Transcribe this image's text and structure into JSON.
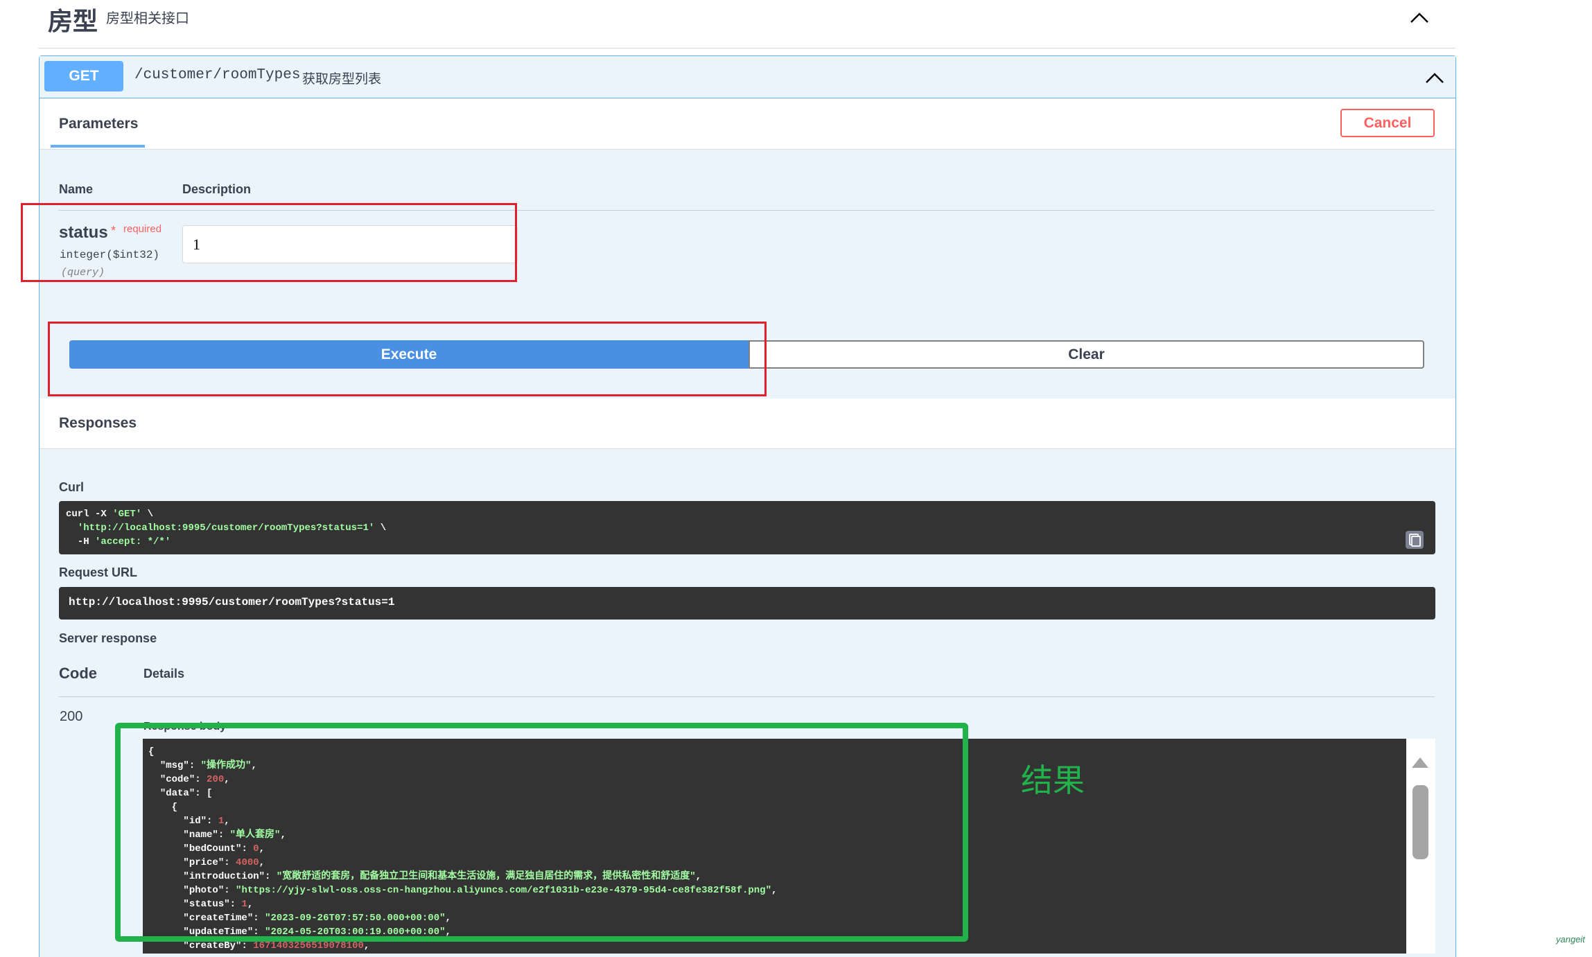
{
  "tag": {
    "name": "房型",
    "description": "房型相关接口"
  },
  "operation": {
    "method": "GET",
    "path": "/customer/roomTypes",
    "summary": "获取房型列表",
    "method_color": "#61affe"
  },
  "params_panel": {
    "tab_label": "Parameters",
    "cancel_label": "Cancel"
  },
  "param_table": {
    "col_name": "Name",
    "col_description": "Description",
    "param": {
      "name": "status",
      "required_star": "*",
      "required_label": "required",
      "type": "integer($int32)",
      "in": "(query)",
      "value": "1"
    }
  },
  "actions": {
    "execute_label": "Execute",
    "clear_label": "Clear"
  },
  "responses": {
    "title": "Responses",
    "curl_label": "Curl",
    "curl_lines": {
      "l1_prefix": "curl -X ",
      "l1_method": "'GET'",
      "l1_suffix": " \\",
      "l2_url": "'http://localhost:9995/customer/roomTypes?status=1'",
      "l2_suffix": " \\",
      "l3_prefix": "  -H ",
      "l3_header": "'accept: */*'"
    },
    "request_url_label": "Request URL",
    "request_url": "http://localhost:9995/customer/roomTypes?status=1",
    "server_response_label": "Server response",
    "code_header": "Code",
    "details_header": "Details",
    "status_code": "200",
    "body_label": "Response body",
    "body": {
      "open_brace": "{",
      "msg_key": "\"msg\"",
      "msg_val": "\"操作成功\"",
      "code_key": "\"code\"",
      "code_val": "200",
      "data_key": "\"data\"",
      "data_open": "[",
      "obj_open": "{",
      "id_key": "\"id\"",
      "id_val": "1",
      "name_key": "\"name\"",
      "name_val": "\"单人套房\"",
      "bed_key": "\"bedCount\"",
      "bed_val": "0",
      "price_key": "\"price\"",
      "price_val": "4000",
      "intro_key": "\"introduction\"",
      "intro_val": "\"宽敞舒适的套房，配备独立卫生间和基本生活设施，满足独自居住的需求，提供私密性和舒适度\"",
      "photo_key": "\"photo\"",
      "photo_val": "\"https://yjy-slwl-oss.oss-cn-hangzhou.aliyuncs.com/e2f1031b-e23e-4379-95d4-ce8fe382f58f.png\"",
      "status_key": "\"status\"",
      "status_val": "1",
      "ctime_key": "\"createTime\"",
      "ctime_val": "\"2023-09-26T07:57:50.000+00:00\"",
      "utime_key": "\"updateTime\"",
      "utime_val": "\"2024-05-20T03:00:19.000+00:00\"",
      "cby_key": "\"createBy\"",
      "cby_val": "1671403256519078100"
    }
  },
  "annotation": {
    "result_label": "结果",
    "watermark": "yangeit"
  }
}
